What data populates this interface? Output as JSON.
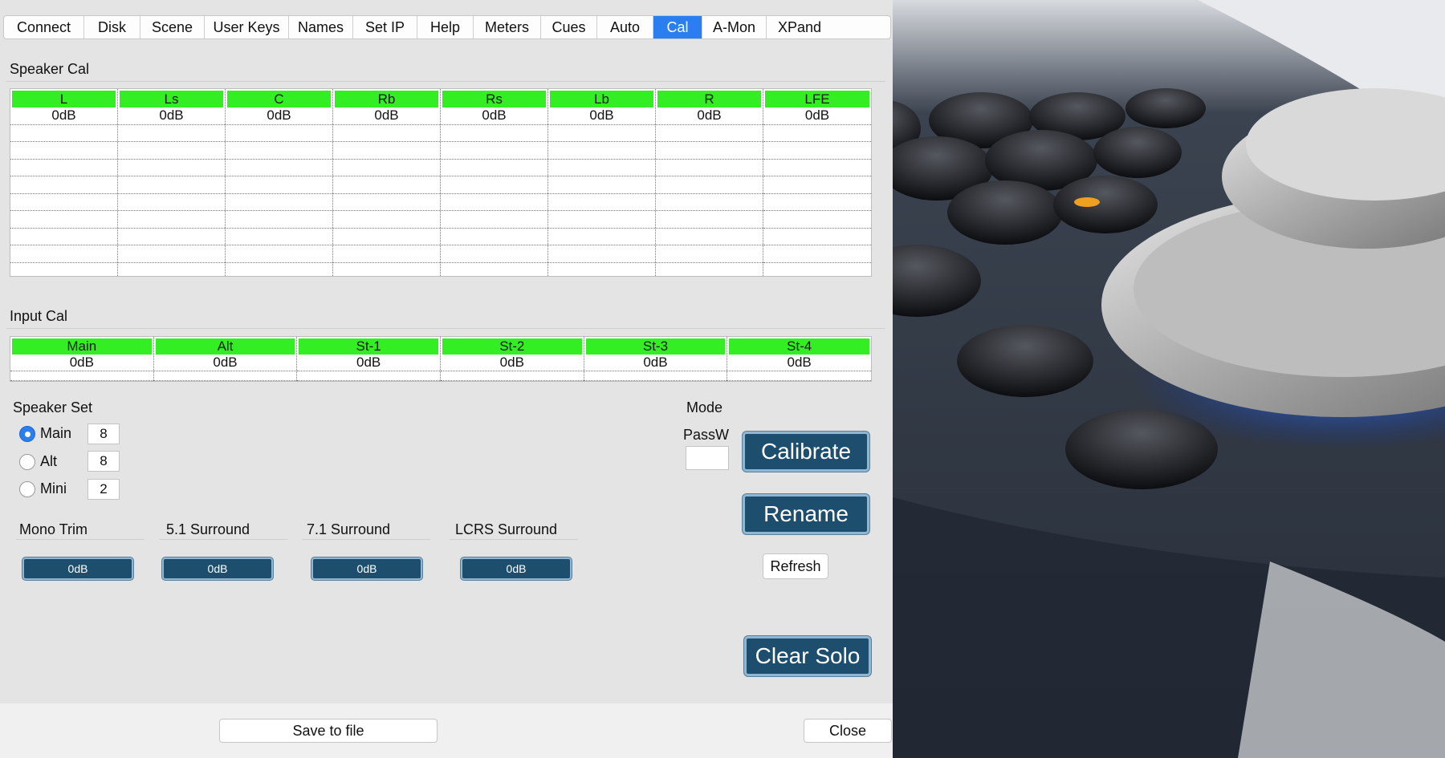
{
  "tabs": [
    {
      "label": "Connect",
      "active": false
    },
    {
      "label": "Disk",
      "active": false
    },
    {
      "label": "Scene",
      "active": false
    },
    {
      "label": "User Keys",
      "active": false
    },
    {
      "label": "Names",
      "active": false
    },
    {
      "label": "Set IP",
      "active": false
    },
    {
      "label": "Help",
      "active": false
    },
    {
      "label": "Meters",
      "active": false
    },
    {
      "label": "Cues",
      "active": false
    },
    {
      "label": "Auto",
      "active": false
    },
    {
      "label": "Cal",
      "active": true
    },
    {
      "label": "A-Mon",
      "active": false
    },
    {
      "label": "XPand",
      "active": false
    }
  ],
  "speaker_cal": {
    "title": "Speaker Cal",
    "columns": [
      {
        "label": "L",
        "value": "0dB"
      },
      {
        "label": "Ls",
        "value": "0dB"
      },
      {
        "label": "C",
        "value": "0dB"
      },
      {
        "label": "Rb",
        "value": "0dB"
      },
      {
        "label": "Rs",
        "value": "0dB"
      },
      {
        "label": "Lb",
        "value": "0dB"
      },
      {
        "label": "R",
        "value": "0dB"
      },
      {
        "label": "LFE",
        "value": "0dB"
      }
    ]
  },
  "input_cal": {
    "title": "Input Cal",
    "columns": [
      {
        "label": "Main",
        "value": "0dB"
      },
      {
        "label": "Alt",
        "value": "0dB"
      },
      {
        "label": "St-1",
        "value": "0dB"
      },
      {
        "label": "St-2",
        "value": "0dB"
      },
      {
        "label": "St-3",
        "value": "0dB"
      },
      {
        "label": "St-4",
        "value": "0dB"
      }
    ]
  },
  "speaker_set": {
    "title": "Speaker Set",
    "options": [
      {
        "label": "Main",
        "count": "8",
        "checked": true
      },
      {
        "label": "Alt",
        "count": "8",
        "checked": false
      },
      {
        "label": "Mini",
        "count": "2",
        "checked": false
      }
    ]
  },
  "trims": [
    {
      "label": "Mono Trim",
      "value": "0dB"
    },
    {
      "label": "5.1 Surround",
      "value": "0dB"
    },
    {
      "label": "7.1 Surround",
      "value": "0dB"
    },
    {
      "label": "LCRS Surround",
      "value": "0dB"
    }
  ],
  "mode": {
    "title": "Mode",
    "passw_label": "PassW",
    "passw_value": ""
  },
  "buttons": {
    "calibrate": "Calibrate",
    "rename": "Rename",
    "refresh": "Refresh",
    "clear_solo": "Clear Solo",
    "save": "Save to file",
    "close": "Close"
  },
  "colors": {
    "accent": "#2a7ef0",
    "header_green": "#33ee22",
    "button_navy": "#1d4e6e"
  }
}
